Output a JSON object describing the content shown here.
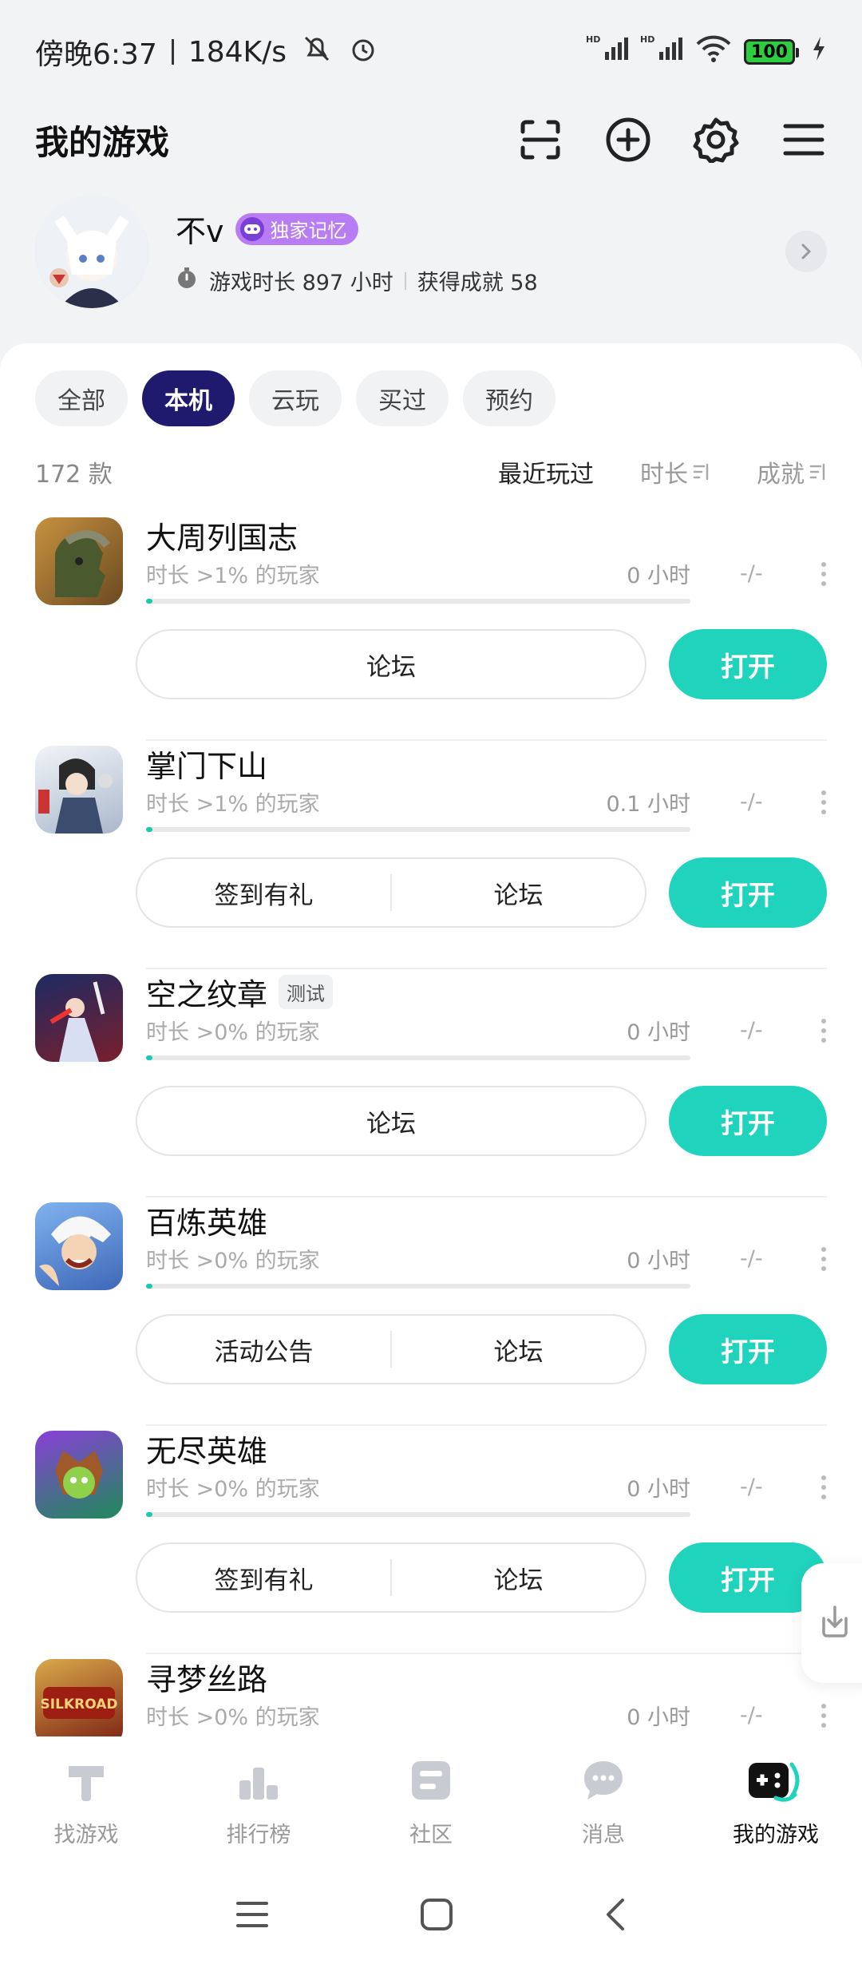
{
  "status_bar": {
    "time": "傍晚6:37",
    "network_speed": "184K/s",
    "battery": "100",
    "icons": [
      "mute-icon",
      "alarm-icon",
      "hd-signal-icon",
      "hd-signal-icon",
      "wifi-icon",
      "battery-icon",
      "charging-icon"
    ]
  },
  "header": {
    "title": "我的游戏",
    "actions": [
      "scan-icon",
      "add-icon",
      "settings-icon",
      "menu-icon"
    ]
  },
  "profile": {
    "name": "不v",
    "badge": "独家记忆",
    "playtime": "游戏时长 897 小时",
    "achievements": "获得成就 58"
  },
  "filters": {
    "tabs": [
      "全部",
      "本机",
      "云玩",
      "买过",
      "预约"
    ],
    "active": "本机"
  },
  "sort": {
    "count": "172 款",
    "options": [
      "最近玩过",
      "时长",
      "成就"
    ],
    "active": "最近玩过"
  },
  "games": [
    {
      "title": "大周列国志",
      "tag": "",
      "meta": "时长 >1% 的玩家",
      "hours": "0 小时",
      "achievement": "-/-",
      "progress": 0.01,
      "buttons": [
        "论坛"
      ],
      "open": "打开",
      "icon_color": "#8a6a3c"
    },
    {
      "title": "掌门下山",
      "tag": "",
      "meta": "时长 >1% 的玩家",
      "hours": "0.1 小时",
      "achievement": "-/-",
      "progress": 0.01,
      "buttons": [
        "签到有礼",
        "论坛"
      ],
      "open": "打开",
      "icon_color": "#c9d6e6"
    },
    {
      "title": "空之纹章",
      "tag": "测试",
      "meta": "时长 >0% 的玩家",
      "hours": "0 小时",
      "achievement": "-/-",
      "progress": 0.01,
      "buttons": [
        "论坛"
      ],
      "open": "打开",
      "icon_color": "#2b3a78"
    },
    {
      "title": "百炼英雄",
      "tag": "",
      "meta": "时长 >0% 的玩家",
      "hours": "0 小时",
      "achievement": "-/-",
      "progress": 0.01,
      "buttons": [
        "活动公告",
        "论坛"
      ],
      "open": "打开",
      "icon_color": "#5a8fd8"
    },
    {
      "title": "无尽英雄",
      "tag": "",
      "meta": "时长 >0% 的玩家",
      "hours": "0 小时",
      "achievement": "-/-",
      "progress": 0.01,
      "buttons": [
        "签到有礼",
        "论坛"
      ],
      "open": "打开",
      "icon_color": "#3aa863"
    },
    {
      "title": "寻梦丝路",
      "tag": "",
      "meta": "时长 >0% 的玩家",
      "hours": "0 小时",
      "achievement": "-/-",
      "progress": 0.01,
      "buttons": [],
      "open": "",
      "icon_color": "#b23a1e"
    }
  ],
  "bottom_nav": {
    "items": [
      {
        "label": "找游戏",
        "icon": "find-game-icon"
      },
      {
        "label": "排行榜",
        "icon": "ranking-icon"
      },
      {
        "label": "社区",
        "icon": "community-icon"
      },
      {
        "label": "消息",
        "icon": "message-icon"
      },
      {
        "label": "我的游戏",
        "icon": "my-games-icon"
      }
    ],
    "active": "我的游戏"
  },
  "system_nav": [
    "recents-icon",
    "home-icon",
    "back-icon"
  ]
}
